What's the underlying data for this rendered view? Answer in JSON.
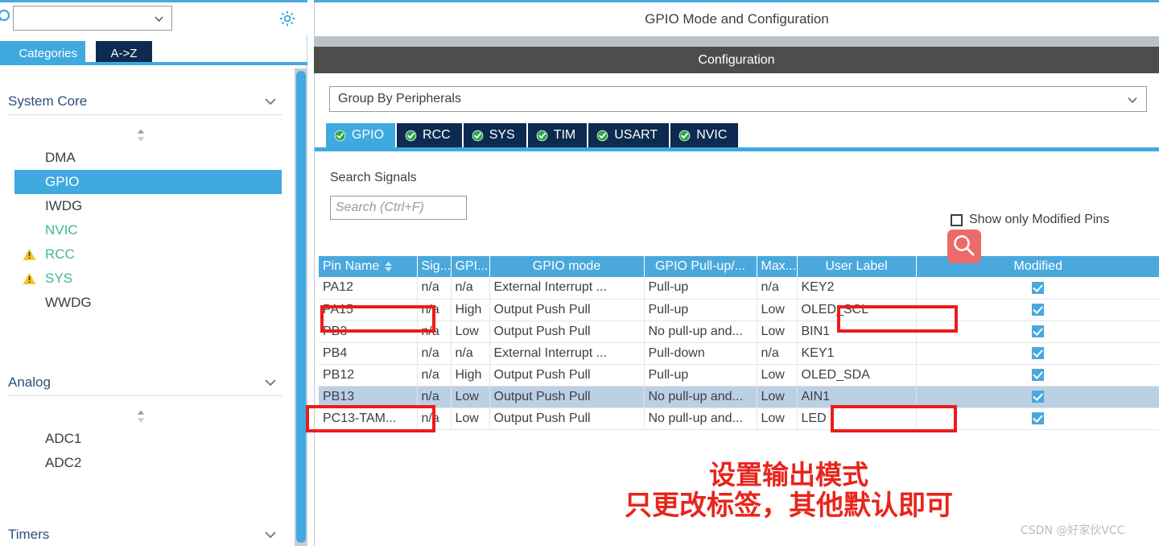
{
  "colors": {
    "accent_blue": "#3fa9e0",
    "tab_navy": "#0d2b50",
    "header_grey": "#4d4d4b",
    "annotation_red": "#ee1b1b",
    "row_selected": "#bcd0e3",
    "green_text": "#3fb89a",
    "cursor_badge": "#ec6a6a"
  },
  "sidebar": {
    "search_placeholder": "",
    "search_icon": "search-icon",
    "gear_icon": "gear-icon",
    "tabs": [
      {
        "label": "Categories",
        "active": true
      },
      {
        "label": "A->Z",
        "active": false
      }
    ],
    "groups": [
      {
        "label": "System Core",
        "chevron": "chevron-down-icon",
        "items": [
          {
            "label": "DMA",
            "state": "normal",
            "warn": false
          },
          {
            "label": "GPIO",
            "state": "selected",
            "warn": false
          },
          {
            "label": "IWDG",
            "state": "normal",
            "warn": false
          },
          {
            "label": "NVIC",
            "state": "green",
            "warn": false
          },
          {
            "label": "RCC",
            "state": "green",
            "warn": true
          },
          {
            "label": "SYS",
            "state": "green",
            "warn": true
          },
          {
            "label": "WWDG",
            "state": "normal",
            "warn": false
          }
        ]
      },
      {
        "label": "Analog",
        "chevron": "chevron-down-icon",
        "items": [
          {
            "label": "ADC1",
            "state": "normal",
            "warn": false
          },
          {
            "label": "ADC2",
            "state": "normal",
            "warn": false
          }
        ]
      },
      {
        "label": "Timers",
        "chevron": "chevron-down-icon",
        "items": []
      }
    ]
  },
  "panel": {
    "title": "GPIO Mode and Configuration",
    "configuration_bar": "Configuration",
    "group_by": {
      "value": "Group By Peripherals",
      "chevron": "chevron-down-icon"
    },
    "peripheral_tabs": [
      {
        "label": "GPIO",
        "active": true,
        "status_icon": "check-circle-icon"
      },
      {
        "label": "RCC",
        "active": false,
        "status_icon": "check-circle-icon"
      },
      {
        "label": "SYS",
        "active": false,
        "status_icon": "check-circle-icon"
      },
      {
        "label": "TIM",
        "active": false,
        "status_icon": "check-circle-icon"
      },
      {
        "label": "USART",
        "active": false,
        "status_icon": "check-circle-icon"
      },
      {
        "label": "NVIC",
        "active": false,
        "status_icon": "check-circle-icon"
      }
    ],
    "search_signals_label": "Search Signals",
    "signal_search_placeholder": "Search (Ctrl+F)",
    "signal_search_value": "",
    "show_only_modified": {
      "label": "Show only Modified Pins",
      "checked": false
    },
    "magnifier_cursor_icon": "search-icon"
  },
  "table": {
    "columns": [
      {
        "label": "Pin Name",
        "sortable": true,
        "align": "left"
      },
      {
        "label": "Sig...",
        "sortable": false,
        "align": "left"
      },
      {
        "label": "GPI...",
        "sortable": false,
        "align": "left"
      },
      {
        "label": "GPIO mode",
        "sortable": false,
        "align": "center"
      },
      {
        "label": "GPIO Pull-up/...",
        "sortable": false,
        "align": "center"
      },
      {
        "label": "Max...",
        "sortable": false,
        "align": "left"
      },
      {
        "label": "User Label",
        "sortable": false,
        "align": "center"
      },
      {
        "label": "Modified",
        "sortable": false,
        "align": "center"
      }
    ],
    "rows": [
      {
        "pin": "PA12",
        "sig": "n/a",
        "gpi": "n/a",
        "mode": "External Interrupt ...",
        "pull": "Pull-up",
        "max": "n/a",
        "label": "KEY2",
        "modified": true,
        "selected": false
      },
      {
        "pin": "PA15",
        "sig": "n/a",
        "gpi": "High",
        "mode": "Output Push Pull",
        "pull": "Pull-up",
        "max": "Low",
        "label": "OLED_SCL",
        "modified": true,
        "selected": false
      },
      {
        "pin": "PB3",
        "sig": "n/a",
        "gpi": "Low",
        "mode": "Output Push Pull",
        "pull": "No pull-up and...",
        "max": "Low",
        "label": "BIN1",
        "modified": true,
        "selected": false
      },
      {
        "pin": "PB4",
        "sig": "n/a",
        "gpi": "n/a",
        "mode": "External Interrupt ...",
        "pull": "Pull-down",
        "max": "n/a",
        "label": "KEY1",
        "modified": true,
        "selected": false
      },
      {
        "pin": "PB12",
        "sig": "n/a",
        "gpi": "High",
        "mode": "Output Push Pull",
        "pull": "Pull-up",
        "max": "Low",
        "label": "OLED_SDA",
        "modified": true,
        "selected": false
      },
      {
        "pin": "PB13",
        "sig": "n/a",
        "gpi": "Low",
        "mode": "Output Push Pull",
        "pull": "No pull-up and...",
        "max": "Low",
        "label": "AIN1",
        "modified": true,
        "selected": true
      },
      {
        "pin": "PC13-TAM...",
        "sig": "n/a",
        "gpi": "Low",
        "mode": "Output Push Pull",
        "pull": "No pull-up and...",
        "max": "Low",
        "label": "LED",
        "modified": true,
        "selected": false
      }
    ]
  },
  "annotations": {
    "line1": "设置输出模式",
    "line2": "只更改标签，其他默认即可",
    "watermark": "CSDN @好家伙VCC"
  }
}
